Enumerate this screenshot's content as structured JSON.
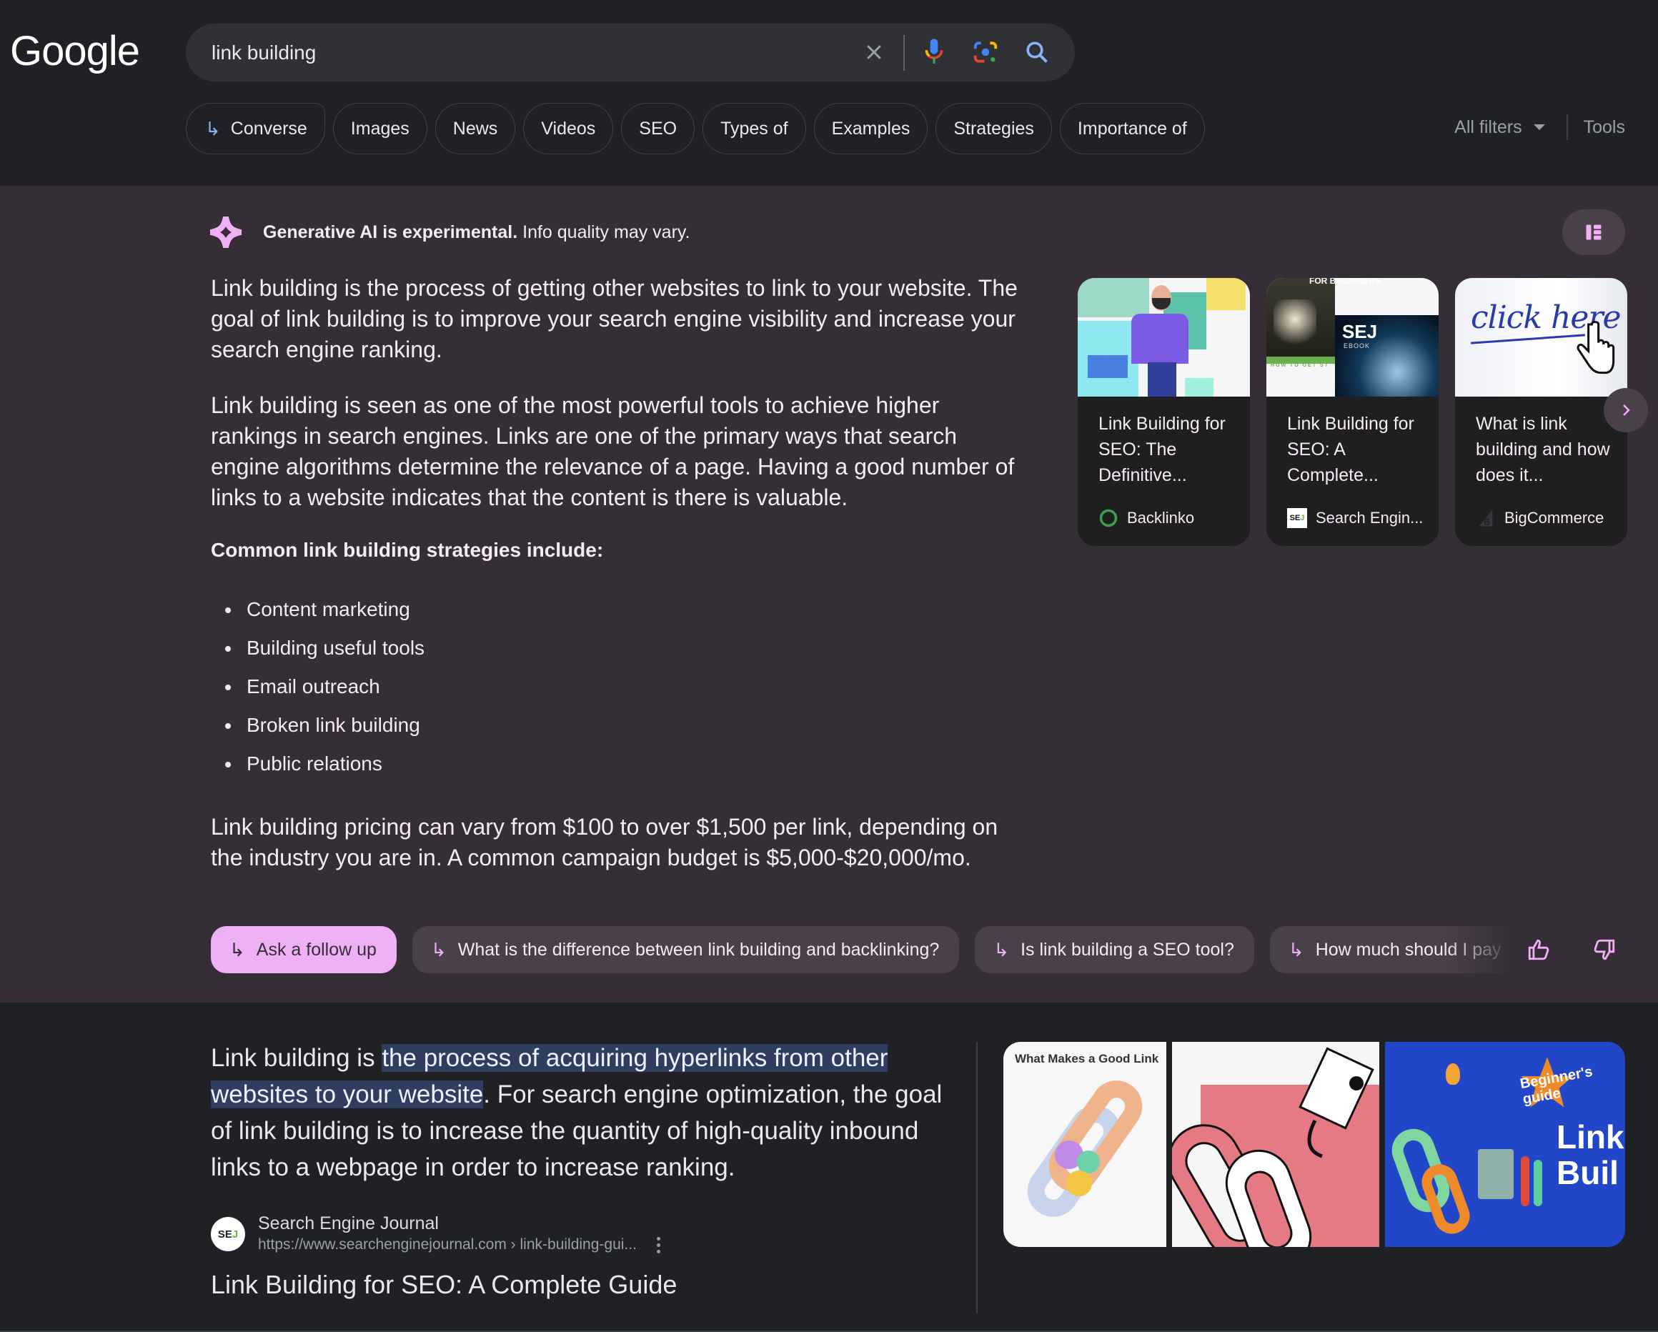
{
  "header": {
    "logo": "Google",
    "search": {
      "value": "link building",
      "placeholder": ""
    },
    "chips": [
      {
        "label": "Converse",
        "icon": "reply-arrow-icon"
      },
      {
        "label": "Images"
      },
      {
        "label": "News"
      },
      {
        "label": "Videos"
      },
      {
        "label": "SEO"
      },
      {
        "label": "Types of"
      },
      {
        "label": "Examples"
      },
      {
        "label": "Strategies"
      },
      {
        "label": "Importance of"
      }
    ],
    "all_filters": "All filters",
    "tools": "Tools"
  },
  "ai_overview": {
    "notice_bold": "Generative AI is experimental.",
    "notice_rest": " Info quality may vary.",
    "paragraphs": [
      "Link building is the process of getting other websites to link to your website. The goal of link building is to improve your search engine visibility and increase your search engine ranking.",
      "Link building is seen as one of the most powerful tools to achieve higher rankings in search engines. Links are one of the primary ways that search engine algorithms determine the relevance of a page. Having a good number of links to a website indicates that the content is there is valuable."
    ],
    "strategies_heading": "Common link building strategies include:",
    "strategies": [
      "Content marketing",
      "Building useful tools",
      "Email outreach",
      "Broken link building",
      "Public relations"
    ],
    "pricing": "Link building pricing can vary from $100 to over $1,500 per link, depending on the industry you are in. A common campaign budget is $5,000-$20,000/mo.",
    "cards": [
      {
        "title": "Link Building for SEO: The Definitive...",
        "source": "Backlinko"
      },
      {
        "title": "Link Building for SEO: A Complete...",
        "source": "Search Engin..."
      },
      {
        "title": "What is link building and how does it...",
        "source": "BigCommerce"
      }
    ],
    "card_thumb_text": {
      "sej_ebook_top": "FOR BEGINNERS",
      "sej_logo": "SEJ",
      "sej_ebook": "EBOOK",
      "sej_howto": "HOW TO GET ST",
      "click_here": "click here"
    },
    "follow_ups": [
      "Ask a follow up",
      "What is the difference between link building and backlinking?",
      "Is link building a SEO tool?",
      "How much should I pay for link building?"
    ]
  },
  "result": {
    "snippet_pre": "Link building is ",
    "snippet_highlight": "the process of acquiring hyperlinks from other websites to your website",
    "snippet_post": ". For search engine optimization, the goal of link building is to increase the quantity of high-quality inbound links to a webpage in order to increase ranking.",
    "source_name": "Search Engine Journal",
    "source_url": "https://www.searchenginejournal.com › link-building-gui...",
    "source_favicon": "SEJ",
    "title": "Link Building for SEO: A Complete Guide",
    "image_text": {
      "good_link_title": "What Makes a Good Link",
      "beginners": "Beginner's guide",
      "link_build": "Link Buil"
    }
  },
  "colors": {
    "page_bg": "#202124",
    "ai_bg": "#352e36",
    "ai_accent": "#f0b0f6",
    "highlight": "#2f3d5e",
    "link_blue": "#8ab4f8"
  }
}
